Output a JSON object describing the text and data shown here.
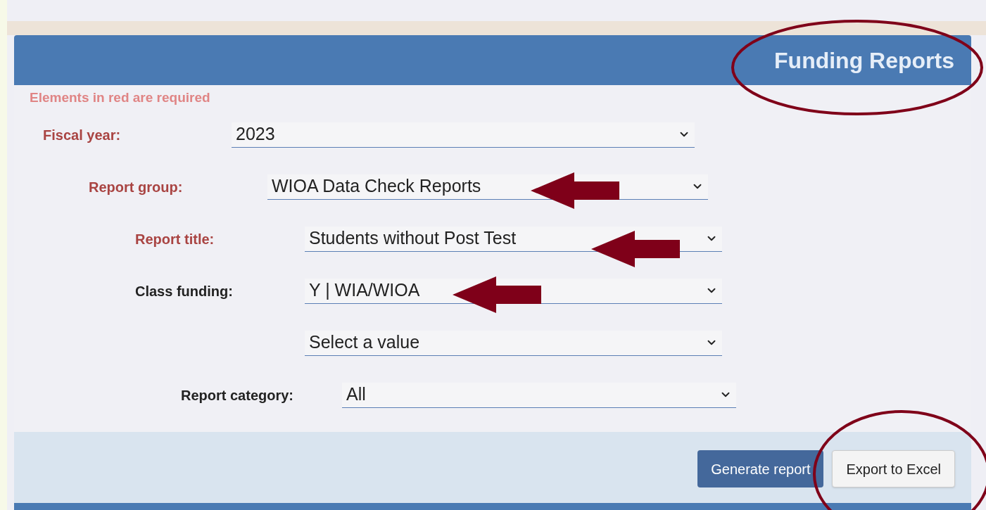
{
  "panel": {
    "title": "Funding Reports",
    "note": "Elements in red are required"
  },
  "fields": [
    {
      "label": "Fiscal year:",
      "required": true,
      "value": "2023"
    },
    {
      "label": "Report group:",
      "required": true,
      "value": "WIOA Data Check Reports"
    },
    {
      "label": "Report title:",
      "required": true,
      "value": "Students without Post Test"
    },
    {
      "label": "Class funding:",
      "required": false,
      "value": "Y | WIA/WIOA"
    },
    {
      "value": "Select a value"
    },
    {
      "label": "Report category:",
      "required": false,
      "value": "All"
    }
  ],
  "buttons": [
    {
      "label": "Generate report",
      "kind": "primary"
    },
    {
      "label": "Export to Excel",
      "kind": "secondary"
    }
  ]
}
